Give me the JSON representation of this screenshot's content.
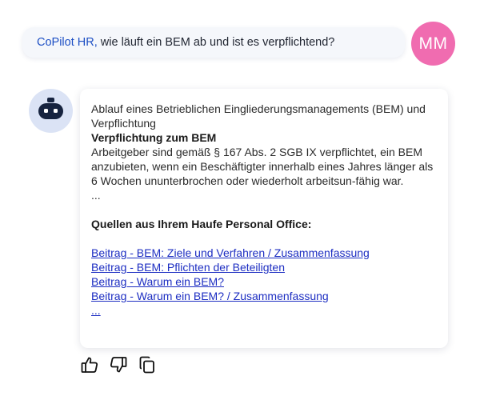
{
  "user_message": {
    "mention": "CoPilot HR,",
    "text": " wie läuft ein BEM ab und ist es verpflichtend?",
    "avatar_initials": "MM"
  },
  "bot": {
    "avatar_icon": "robot-icon",
    "intro": "Ablauf eines Betrieblichen Eingliederungsmanagements (BEM) und Verpflichtung",
    "section_title": "Verpflichtung zum BEM",
    "section_text": "Arbeitgeber sind gemäß § 167 Abs. 2 SGB IX verpflichtet, ein BEM anzubieten, wenn ein Beschäftigter innerhalb eines Jahres länger als 6 Wochen ununterbrochen oder wiederholt arbeitsun-fähig war.",
    "ellipsis": "...",
    "sources_title": "Quellen aus Ihrem Haufe Personal Office:",
    "sources": [
      "Beitrag - BEM: Ziele und Verfahren / Zusammenfassung",
      "Beitrag - BEM: Pflichten der Beteiligten",
      "Beitrag - Warum ein BEM?",
      "Beitrag - Warum ein BEM? / Zusammenfassung"
    ],
    "more_link": "..."
  },
  "actions": {
    "icons": [
      "thumbs-up-icon",
      "thumbs-down-icon",
      "copy-icon"
    ]
  },
  "colors": {
    "link": "#1d2ec2",
    "mention": "#1d4fc4",
    "user_avatar": "#f06cb0",
    "bot_avatar_bg": "#dbe3f5",
    "bot_head": "#16233f"
  }
}
